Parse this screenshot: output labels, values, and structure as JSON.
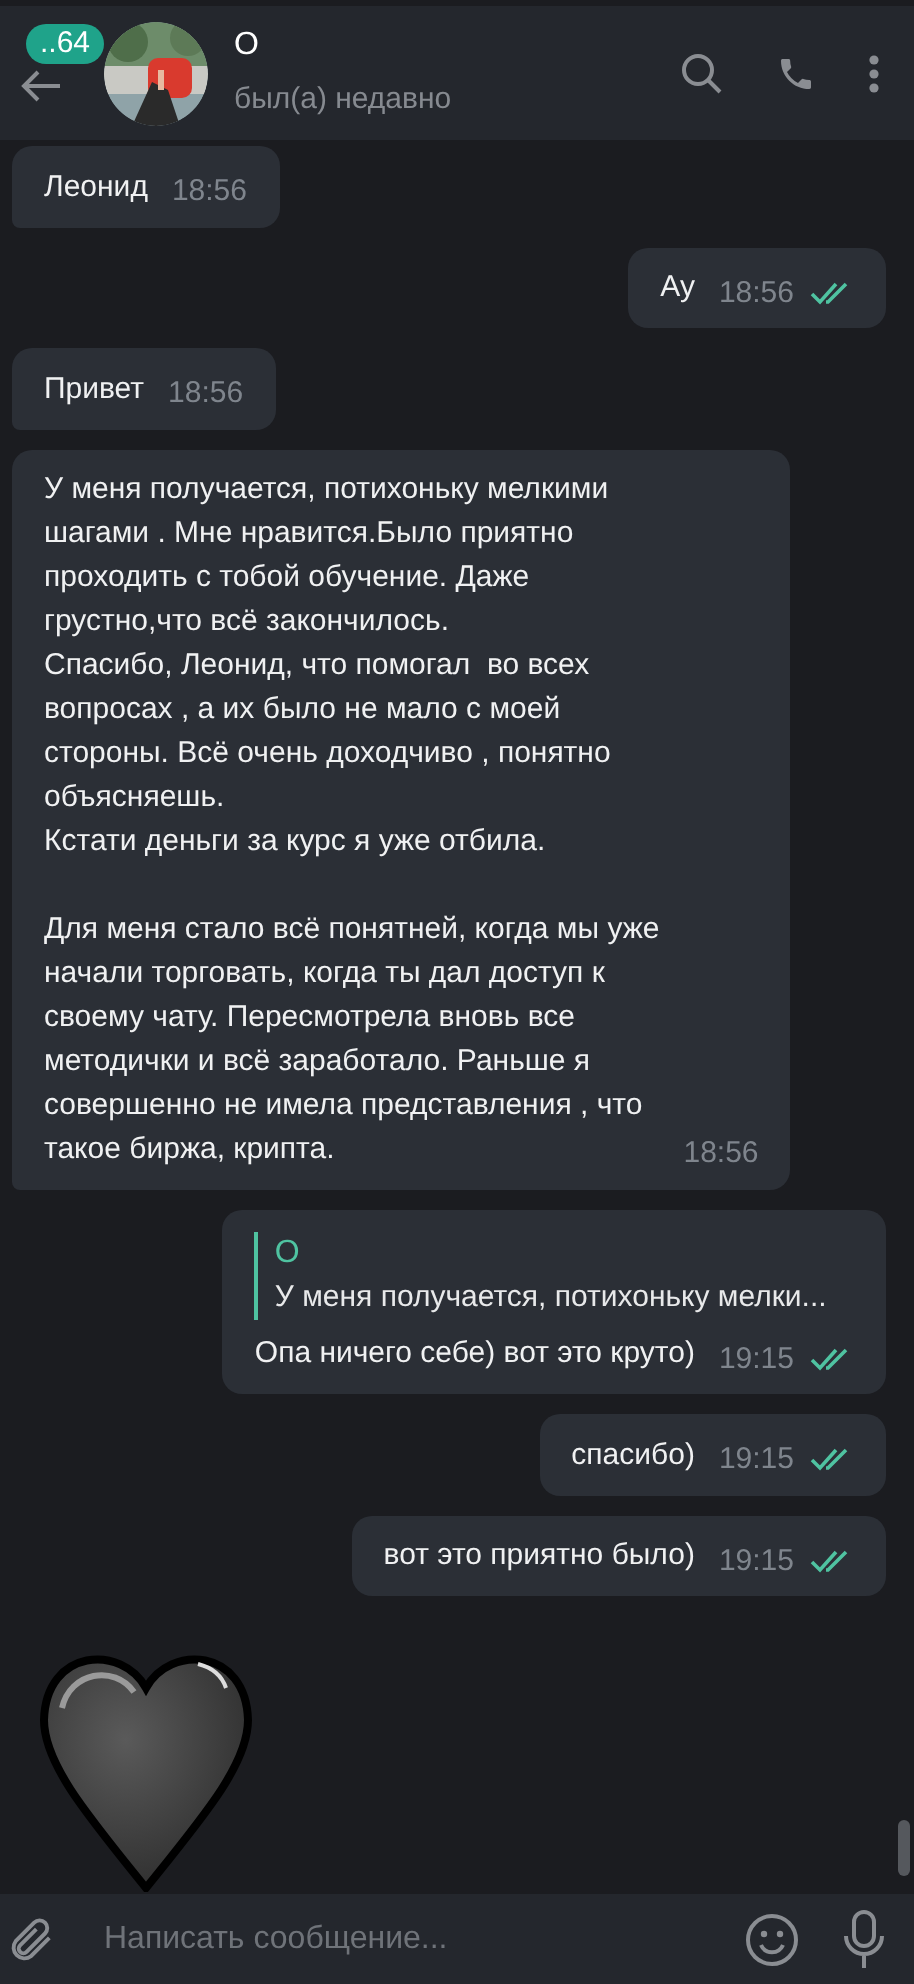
{
  "header": {
    "unread_badge": "..64",
    "name": "О",
    "status": "был(а) недавно"
  },
  "messages": [
    {
      "kind": "text",
      "outgoing": false,
      "text": "Леонид",
      "time": "18:56"
    },
    {
      "kind": "text",
      "outgoing": true,
      "text": "Ау",
      "time": "18:56",
      "read": true
    },
    {
      "kind": "text",
      "outgoing": false,
      "text": "Привет",
      "time": "18:56"
    },
    {
      "kind": "text",
      "outgoing": false,
      "text": "У меня получается, потихоньку мелкими\nшагами . Мне нравится.Было приятно\nпроходить с тобой обучение. Даже\nгрустно,что всё закончилось.\nСпасибо, Леонид, что помогал  во всех\nвопросах , а их было не мало с моей\nстороны. Всё очень доходчиво , понятно\nобъясняешь.\nКстати деньги за курс я уже отбила.\n\nДля меня стало всё понятней, когда мы уже\nначали торговать, когда ты дал доступ к\nсвоему чату. Пересмотрела вновь все\nметодички и всё заработало. Раньше я\nсовершенно не имела представления , что\nтакое биржа, крипта.",
      "time": "18:56"
    },
    {
      "kind": "reply",
      "outgoing": true,
      "reply_to": {
        "author": "О",
        "text": "У меня получается, потихоньку мелки..."
      },
      "text": "Опа ничего себе) вот это круто)",
      "time": "19:15",
      "read": true
    },
    {
      "kind": "text",
      "outgoing": true,
      "text": "спасибо)",
      "time": "19:15",
      "read": true
    },
    {
      "kind": "text",
      "outgoing": true,
      "text": "вот это приятно было)",
      "time": "19:15",
      "read": true
    },
    {
      "kind": "sticker",
      "outgoing": false
    }
  ],
  "composer": {
    "placeholder": "Написать сообщение..."
  }
}
